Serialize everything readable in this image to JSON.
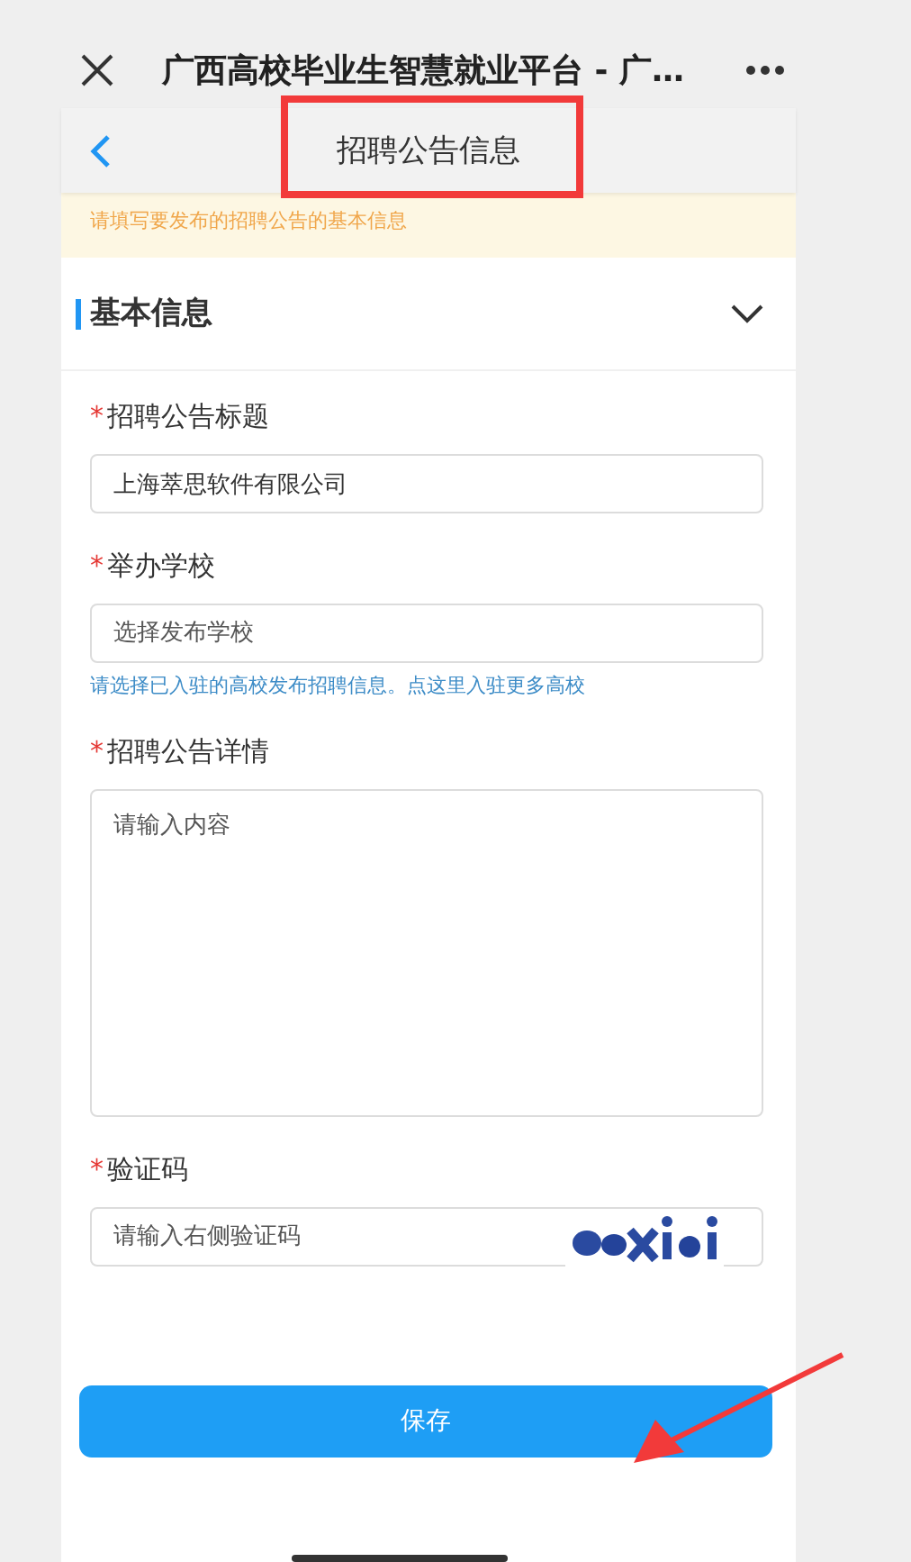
{
  "browser": {
    "title": "广西高校毕业生智慧就业平台 - 广…"
  },
  "nav": {
    "title": "招聘公告信息"
  },
  "notice": "请填写要发布的招聘公告的基本信息",
  "section": {
    "title": "基本信息",
    "expanded": true
  },
  "fields": [
    {
      "kind": "input",
      "required_mark": "*",
      "label": "招聘公告标题",
      "value": "上海萃思软件有限公司"
    },
    {
      "kind": "select",
      "required_mark": "*",
      "label": "举办学校",
      "placeholder": "选择发布学校",
      "hint": "请选择已入驻的高校发布招聘信息。点这里入驻更多高校"
    },
    {
      "kind": "textarea",
      "required_mark": "*",
      "label": "招聘公告详情",
      "placeholder": "请输入内容"
    },
    {
      "kind": "captcha",
      "required_mark": "*",
      "label": "验证码",
      "placeholder": "请输入右侧验证码"
    }
  ],
  "save_button": "保存"
}
